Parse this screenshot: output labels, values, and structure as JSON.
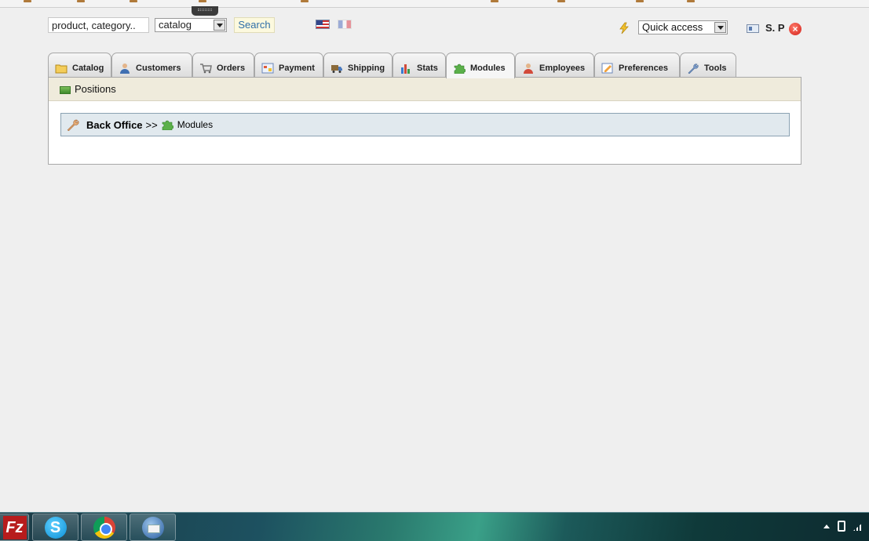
{
  "search": {
    "value": "product, category..",
    "scope": "catalog",
    "button_label": "Search"
  },
  "header": {
    "quick_access_label": "Quick access",
    "user_name": "S. P"
  },
  "tabs": [
    {
      "label": "Catalog",
      "icon": "folder-icon"
    },
    {
      "label": "Customers",
      "icon": "customer-icon"
    },
    {
      "label": "Orders",
      "icon": "cart-icon"
    },
    {
      "label": "Payment",
      "icon": "payment-icon"
    },
    {
      "label": "Shipping",
      "icon": "truck-icon"
    },
    {
      "label": "Stats",
      "icon": "chart-icon"
    },
    {
      "label": "Modules",
      "icon": "puzzle-icon",
      "active": true
    },
    {
      "label": "Employees",
      "icon": "employee-icon"
    },
    {
      "label": "Preferences",
      "icon": "preferences-icon"
    },
    {
      "label": "Tools",
      "icon": "wrench-icon"
    }
  ],
  "subnav": {
    "positions_label": "Positions"
  },
  "breadcrumb": {
    "root": "Back Office",
    "separator": ">>",
    "current": "Modules"
  },
  "colors": {
    "accent_search": "#2f6fa8",
    "panel_bar": "#efebdc",
    "breadcrumb_bg": "#e1e9ee"
  }
}
